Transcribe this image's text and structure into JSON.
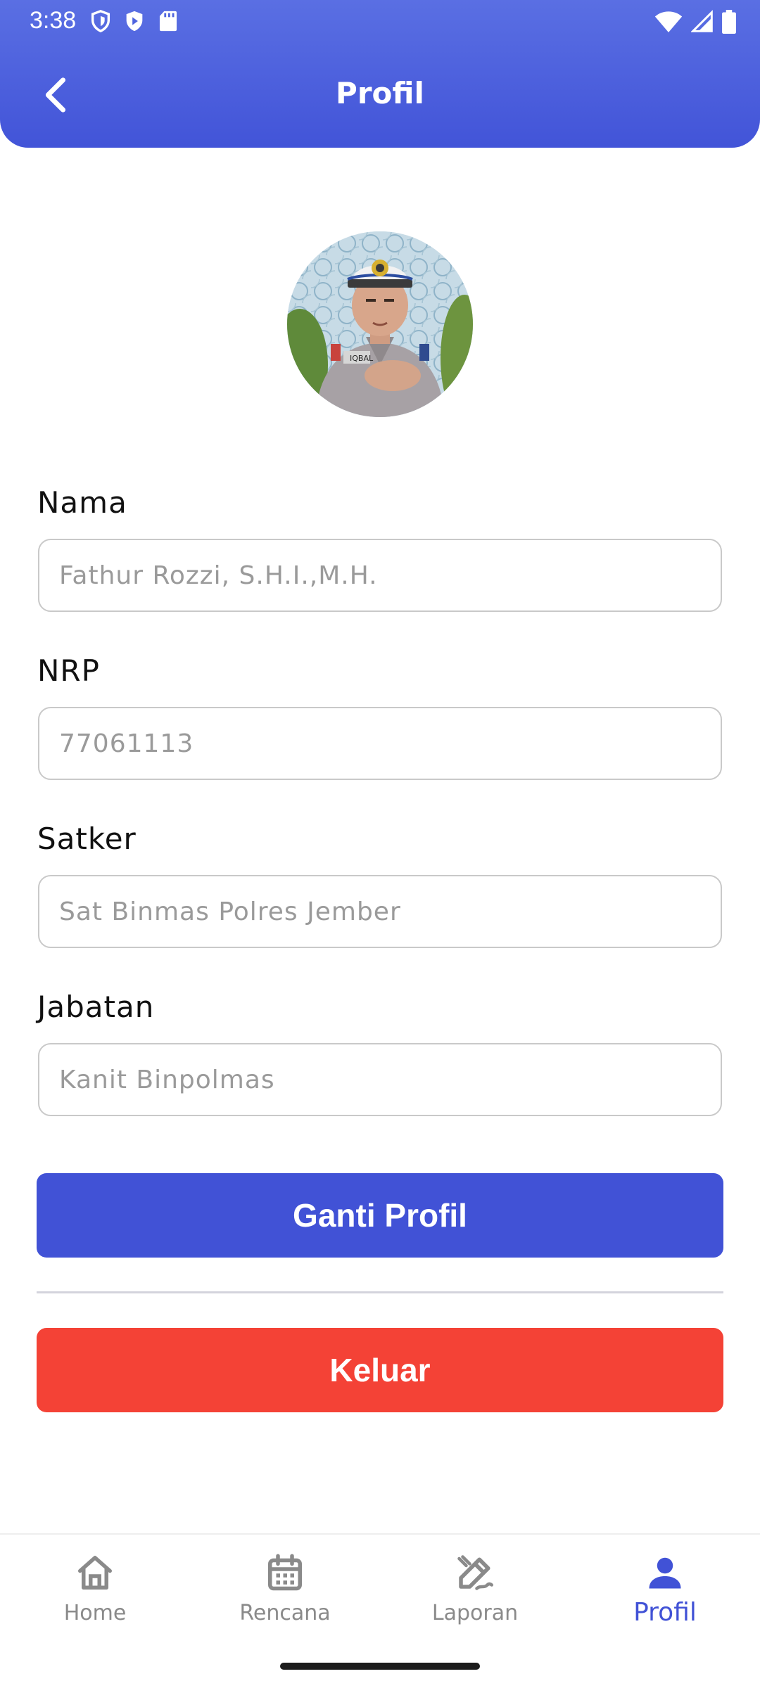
{
  "status_bar": {
    "time": "3:38"
  },
  "header": {
    "title": "Profil"
  },
  "form": {
    "fields": [
      {
        "label": "Nama",
        "placeholder": "Fathur Rozzi, S.H.I.,M.H."
      },
      {
        "label": "NRP",
        "placeholder": "77061113"
      },
      {
        "label": "Satker",
        "placeholder": "Sat Binmas Polres Jember"
      },
      {
        "label": "Jabatan",
        "placeholder": "Kanit Binpolmas"
      }
    ],
    "change_profile_label": "Ganti Profil",
    "logout_label": "Keluar"
  },
  "bottom_nav": {
    "items": [
      {
        "label": "Home",
        "icon": "home-icon"
      },
      {
        "label": "Rencana",
        "icon": "calendar-icon"
      },
      {
        "label": "Laporan",
        "icon": "edit-report-icon"
      },
      {
        "label": "Profil",
        "icon": "person-icon"
      }
    ],
    "active": "Profil"
  },
  "colors": {
    "primary": "#4152d6",
    "danger": "#f44236",
    "header_gradient_top": "#5a6fe3",
    "header_gradient_bottom": "#4254d8",
    "inactive_nav": "#8a8a8a"
  }
}
